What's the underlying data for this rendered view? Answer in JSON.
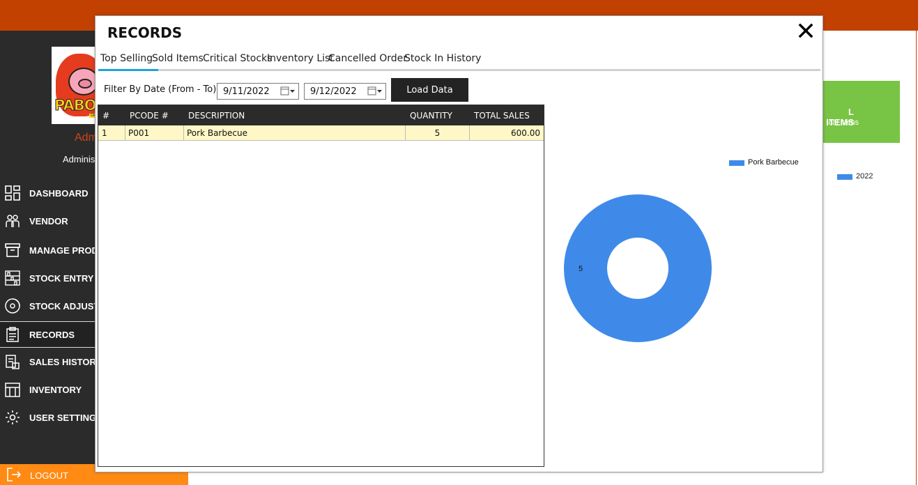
{
  "app": {
    "user_name": "Adm",
    "user_role": "Adminis",
    "nav": [
      {
        "label": "DASHBOARD"
      },
      {
        "label": "VENDOR"
      },
      {
        "label": "MANAGE PROD"
      },
      {
        "label": "STOCK ENTRY"
      },
      {
        "label": "STOCK ADJUSTI"
      },
      {
        "label": "RECORDS"
      },
      {
        "label": "SALES HISTORY"
      },
      {
        "label": "INVENTORY"
      },
      {
        "label": "USER SETTINGS"
      }
    ],
    "logout_label": "LOGOUT",
    "logo_text": "PABOR",
    "behind_card_title": "L ITEMS",
    "behind_card_sub": "cal items",
    "behind_legend": "2022"
  },
  "modal": {
    "title": "RECORDS",
    "tabs": [
      {
        "label": "Top Selling",
        "active": true
      },
      {
        "label": "Sold Items"
      },
      {
        "label": "Critical Stocks"
      },
      {
        "label": "Inventory List"
      },
      {
        "label": "Cancelled Order"
      },
      {
        "label": "Stock In History"
      }
    ],
    "filter_label": "Filter By Date (From - To)",
    "date_from": "9/11/2022",
    "date_to": "9/12/2022",
    "load_button": "Load Data",
    "table": {
      "columns": [
        "#",
        "PCODE #",
        "DESCRIPTION",
        "QUANTITY",
        "TOTAL SALES"
      ],
      "rows": [
        [
          "1",
          "P001",
          "Pork Barbecue",
          "5",
          "600.00"
        ]
      ]
    }
  },
  "chart_data": {
    "type": "pie",
    "title": "",
    "categories": [
      "Pork Barbecue"
    ],
    "values": [
      5
    ],
    "legend": [
      "Pork Barbecue"
    ],
    "legend_position": "top-right",
    "colors": [
      "#3f8ae9"
    ],
    "donut": true
  }
}
